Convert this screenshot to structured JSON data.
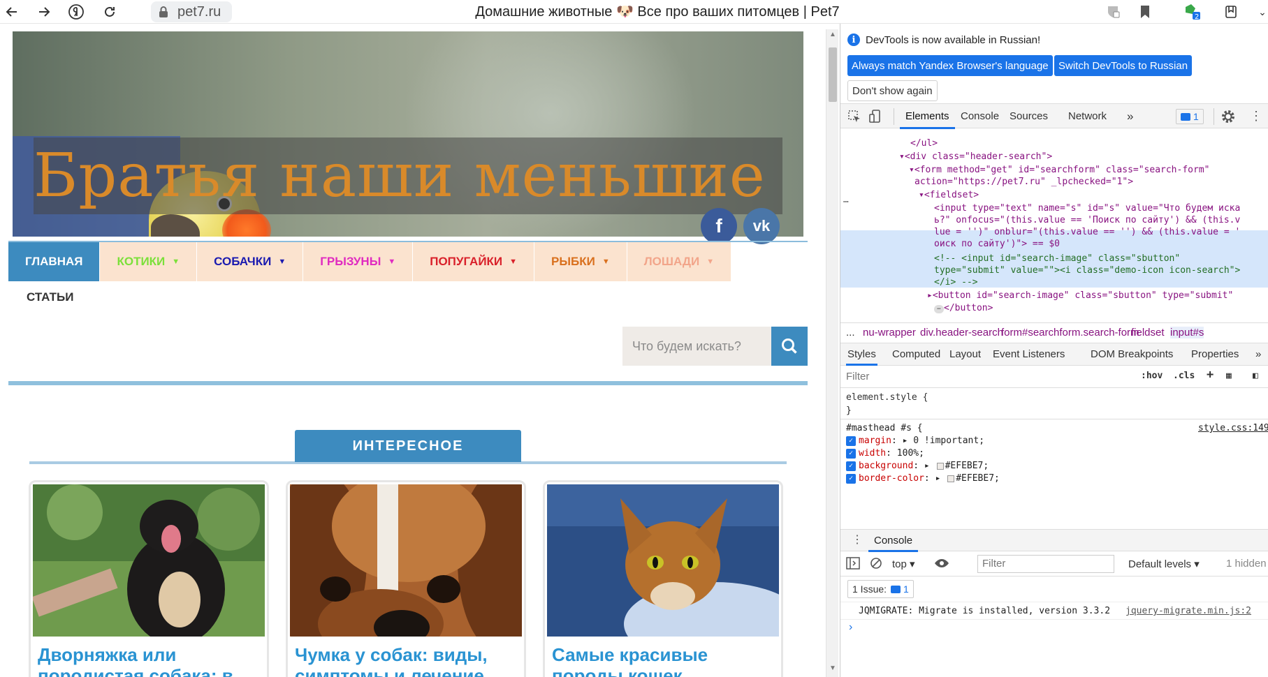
{
  "browser": {
    "url": "pet7.ru",
    "page_title": "Домашние животные 🐶 Все про ваших питомцев | Pet7",
    "icons": [
      "back-icon",
      "forward-icon",
      "yandex-icon",
      "reload-icon",
      "lock-icon",
      "protect-icon",
      "bookmark-icon",
      "extension-icon",
      "collections-icon"
    ]
  },
  "site": {
    "banner_title": "Братья наши меньшие",
    "social": {
      "facebook": "f",
      "vk": "vk"
    },
    "nav": [
      {
        "label": "ГЛАВНАЯ",
        "color": "#ffffff",
        "active": true
      },
      {
        "label": "КОТИКИ",
        "color": "#7be03a",
        "dropdown": true
      },
      {
        "label": "СОБАЧКИ",
        "color": "#1a1ab0",
        "dropdown": true
      },
      {
        "label": "ГРЫЗУНЫ",
        "color": "#e02bc0",
        "dropdown": true
      },
      {
        "label": "ПОПУГАЙКИ",
        "color": "#d9202a",
        "dropdown": true
      },
      {
        "label": "РЫБКИ",
        "color": "#d9701e",
        "dropdown": true
      },
      {
        "label": "ЛОШАДИ",
        "color": "#f2a58a",
        "dropdown": true
      }
    ],
    "nav_articles": "СТАТЬИ",
    "search": {
      "placeholder": "Что будем искать?"
    },
    "interesting_label": "ИНТЕРЕСНОЕ",
    "cards": [
      {
        "title": "Дворняжка или породистая собака: в"
      },
      {
        "title": "Чумка у собак: виды, симптомы и лечение"
      },
      {
        "title": "Самые красивые породы кошек"
      }
    ]
  },
  "devtools": {
    "info": "DevTools is now available in Russian!",
    "btn_match": "Always match Yandex Browser's language",
    "btn_switch": "Switch DevTools to Russian",
    "btn_dont": "Don't show again",
    "tabs": [
      "Elements",
      "Console",
      "Sources",
      "Network"
    ],
    "tabs_more": "»",
    "issues_badge": "1",
    "dom": [
      "</ul>",
      "<div class=\"header-search\">",
      "<form method=\"get\" id=\"searchform\" class=\"search-form\"",
      "action=\"https://pet7.ru\" _lpchecked=\"1\">",
      "<fieldset>",
      "<input type=\"text\" name=\"s\" id=\"s\" value=\"Что будем иска",
      "ь?\" onfocus=\"(this.value == 'Поиск по сайту') && (this.v",
      "lue = '')\" onblur=\"(this.value == '') && (this.value = '",
      "оиск по сайту')\"> == $0",
      "<!-- <input id=\"search-image\" class=\"sbutton\"",
      "type=\"submit\" value=\"\"><i class=\"demo-icon icon-search\">",
      "</i> -->",
      "<button id=\"search-image\" class=\"sbutton\" type=\"submit\"",
      "</button>"
    ],
    "breadcrumbs": [
      "...",
      "nu-wrapper",
      "div.header-search",
      "form#searchform.search-form",
      "fieldset",
      "input#s"
    ],
    "style_tabs": [
      "Styles",
      "Computed",
      "Layout",
      "Event Listeners",
      "DOM Breakpoints",
      "Properties"
    ],
    "filter_placeholder": "Filter",
    "hov": ":hov",
    "cls": ".cls",
    "element_style": "element.style {",
    "close_brace": "}",
    "rule_selector": "#masthead #s {",
    "rule_source": "style.css:149",
    "rules": [
      {
        "prop": "margin",
        "value": "0 !important;"
      },
      {
        "prop": "width",
        "value": "100%;"
      },
      {
        "prop": "background",
        "value": "#EFEBE7;"
      },
      {
        "prop": "border-color",
        "value": "#EFEBE7;"
      }
    ],
    "console_tab": "Console",
    "console_top": "top",
    "console_filter": "Filter",
    "console_levels": "Default levels",
    "console_hidden": "1 hidden",
    "issue_label": "1 Issue:",
    "issue_count": "1",
    "console_msg": "JQMIGRATE: Migrate is installed, version 3.3.2",
    "console_src": "jquery-migrate.min.js:2",
    "prompt": "›"
  }
}
